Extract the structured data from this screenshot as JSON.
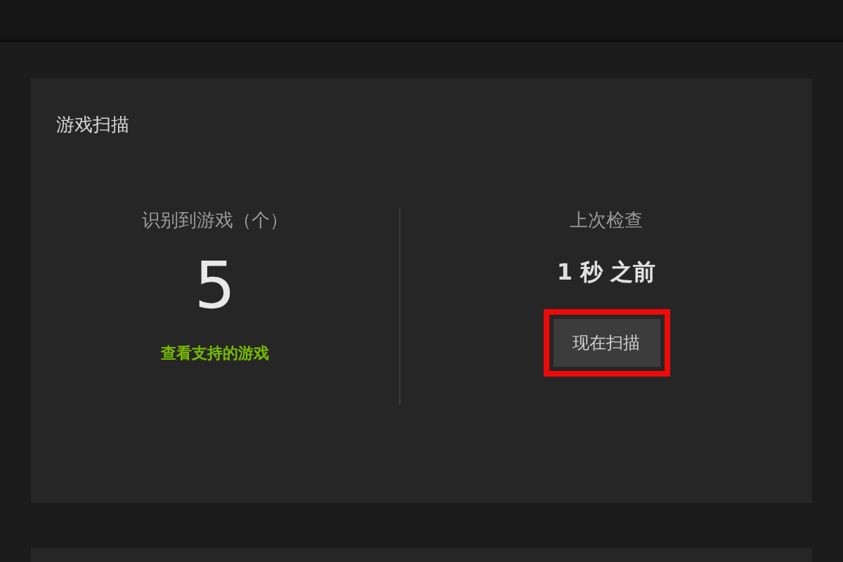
{
  "panel": {
    "title": "游戏扫描",
    "detected": {
      "label": "识别到游戏（个）",
      "count": "5",
      "link": "查看支持的游戏"
    },
    "last_check": {
      "label": "上次检查",
      "time": "1 秒 之前",
      "button": "现在扫描"
    }
  }
}
